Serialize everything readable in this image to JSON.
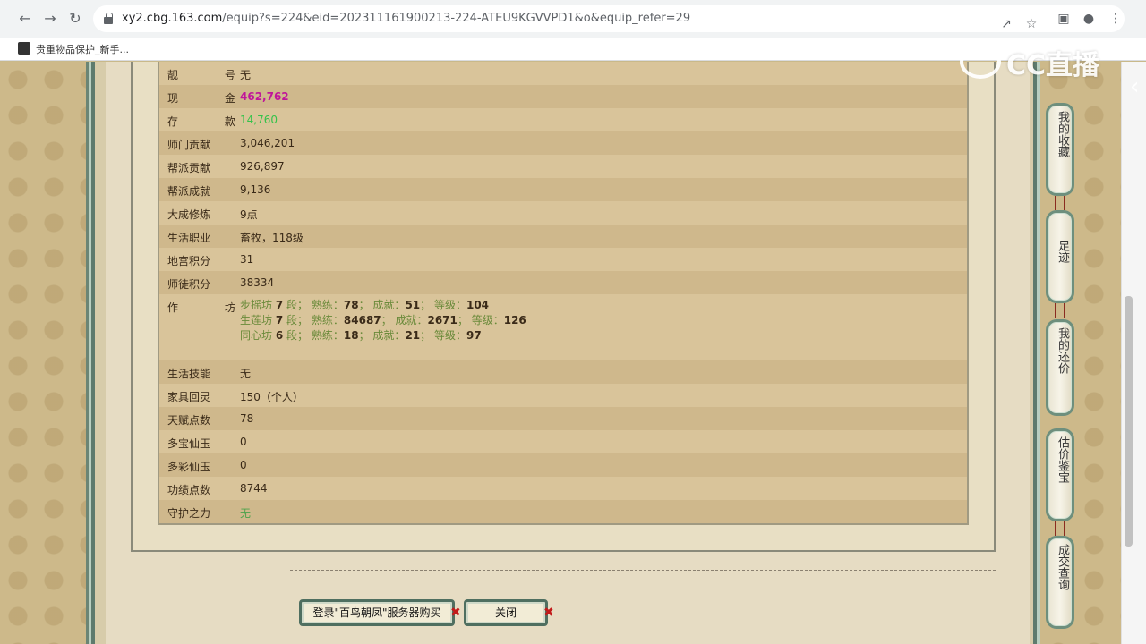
{
  "browser": {
    "url_host": "xy2.cbg.163.com",
    "url_rest": "/equip?s=224&eid=202311161900213-224-ATEU9KGVVPD1&o&equip_refer=29",
    "bookmark_label": "贵重物品保护_新手..."
  },
  "rows": [
    {
      "label": "靓 号",
      "value": "无",
      "style": "normal"
    },
    {
      "label": "现 金",
      "value": "462,762",
      "style": "magenta"
    },
    {
      "label": "存 款",
      "value": "14,760",
      "style": "green"
    },
    {
      "label": "师门贡献",
      "value": "3,046,201",
      "style": "normal"
    },
    {
      "label": "帮派贡献",
      "value": "926,897",
      "style": "normal"
    },
    {
      "label": "帮派成就",
      "value": "9,136",
      "style": "normal"
    },
    {
      "label": "大成修炼",
      "value": "9点",
      "style": "normal"
    },
    {
      "label": "生活职业",
      "value": "畜牧，118级",
      "style": "normal"
    },
    {
      "label": "地宫积分",
      "value": "31",
      "style": "normal"
    },
    {
      "label": "师徒积分",
      "value": "38334",
      "style": "normal"
    }
  ],
  "workshop": {
    "label": "作 坊",
    "lines": [
      {
        "name": "步摇坊",
        "level": "7",
        "skill": "78",
        "achieve": "51",
        "grade": "104"
      },
      {
        "name": "生莲坊",
        "level": "7",
        "skill": "84687",
        "achieve": "2671",
        "grade": "126"
      },
      {
        "name": "同心坊",
        "level": "6",
        "skill": "18",
        "achieve": "21",
        "grade": "97"
      }
    ],
    "seg_word": "段；",
    "skill_word": "熟练：",
    "achieve_word": "成就：",
    "grade_word": "等级："
  },
  "rows2": [
    {
      "label": "生活技能",
      "value": "无",
      "style": "normal"
    },
    {
      "label": "家具回灵",
      "value": "150（个人）",
      "style": "normal"
    },
    {
      "label": "天赋点数",
      "value": "78",
      "style": "normal"
    },
    {
      "label": "多宝仙玉",
      "value": "0",
      "style": "normal"
    },
    {
      "label": "多彩仙玉",
      "value": "0",
      "style": "normal"
    },
    {
      "label": "功绩点数",
      "value": "8744",
      "style": "normal"
    },
    {
      "label": "守护之力",
      "value": "无",
      "style": "green-light"
    }
  ],
  "buttons": {
    "login_buy": "登录\"百鸟朝凤\"服务器购买",
    "close": "关闭"
  },
  "side_tabs": [
    "我的收藏",
    "足迹",
    "我的还价",
    "估价鉴宝",
    "成交查询"
  ],
  "watermark": "CC直播"
}
